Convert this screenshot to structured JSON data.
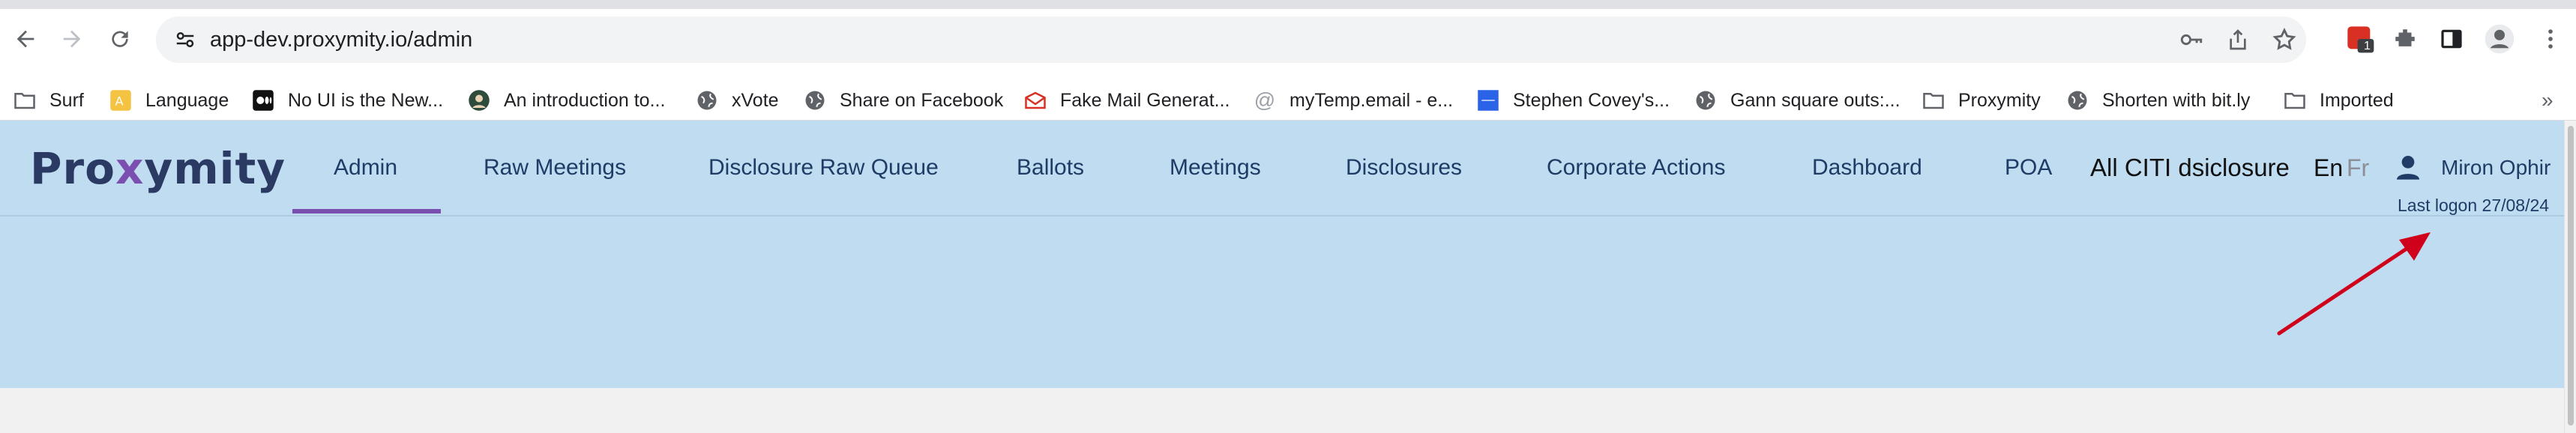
{
  "browser": {
    "url": "app-dev.proxymity.io/admin",
    "extension_badge": "1",
    "icons": [
      "back-icon",
      "forward-icon",
      "reload-icon",
      "site-info-icon",
      "key-icon",
      "share-icon",
      "star-icon",
      "puzzle-icon",
      "sidebar-icon",
      "profile-icon",
      "menu-icon"
    ]
  },
  "bookmarks": [
    {
      "label": "Surf"
    },
    {
      "label": "Language"
    },
    {
      "label": "No UI is the New..."
    },
    {
      "label": "An introduction to..."
    },
    {
      "label": "xVote"
    },
    {
      "label": "Share on Facebook"
    },
    {
      "label": "Fake Mail Generat..."
    },
    {
      "label": "myTemp.email - e..."
    },
    {
      "label": "Stephen Covey's..."
    },
    {
      "label": "Gann square outs:..."
    },
    {
      "label": "Proxymity"
    },
    {
      "label": "Shorten with bit.ly"
    },
    {
      "label": "Imported"
    }
  ],
  "bookmarks_overflow": "»",
  "app": {
    "logo_prefix": "Pro",
    "logo_x": "x",
    "logo_suffix": "ymity",
    "nav": [
      {
        "label": "Admin",
        "active": true
      },
      {
        "label": "Raw Meetings"
      },
      {
        "label": "Disclosure Raw Queue"
      },
      {
        "label": "Ballots"
      },
      {
        "label": "Meetings"
      },
      {
        "label": "Disclosures"
      },
      {
        "label": "Corporate Actions"
      },
      {
        "label": "Dashboard"
      },
      {
        "label": "POA"
      },
      {
        "label": "All CITI dsiclosure"
      }
    ],
    "lang_en": "En",
    "lang_fr": "Fr",
    "user_name": "Miron Ophir",
    "last_logon": "Last logon 27/08/24"
  },
  "colors": {
    "header_bg": "#bfdcf0",
    "nav_text": "#1f3b66",
    "accent": "#7a4fb0",
    "arrow": "#d0021b"
  }
}
